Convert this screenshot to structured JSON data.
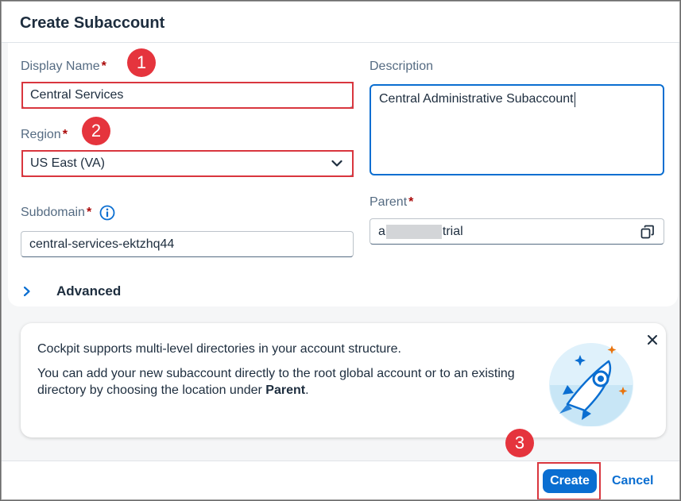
{
  "dialog": {
    "title": "Create Subaccount"
  },
  "form": {
    "display_name": {
      "label": "Display Name",
      "required": "*",
      "value": "Central Services"
    },
    "region": {
      "label": "Region",
      "required": "*",
      "value": "US East (VA)"
    },
    "subdomain": {
      "label": "Subdomain",
      "required": "*",
      "value": "central-services-ektzhq44"
    },
    "description": {
      "label": "Description",
      "value": "Central Administrative Subaccount"
    },
    "parent": {
      "label": "Parent",
      "required": "*",
      "value_prefix": "a",
      "value_suffix": "trial"
    },
    "advanced": {
      "label": "Advanced"
    }
  },
  "info": {
    "line1": "Cockpit supports multi-level directories in your account structure.",
    "line2_pre": "You can add your new subaccount directly to the root global account or to an existing directory by choosing the location under ",
    "line2_bold": "Parent",
    "line2_post": "."
  },
  "footer": {
    "create_label": "Create",
    "cancel_label": "Cancel"
  },
  "annotations": {
    "step1": "1",
    "step2": "2",
    "step3": "3"
  },
  "colors": {
    "accent": "#0a6ed1",
    "highlight": "#d9363e",
    "required": "#aa0808"
  },
  "icons": [
    "info-icon",
    "chevron-down-icon",
    "chevron-right-icon",
    "copy-icon",
    "close-icon",
    "rocket-illustration"
  ]
}
